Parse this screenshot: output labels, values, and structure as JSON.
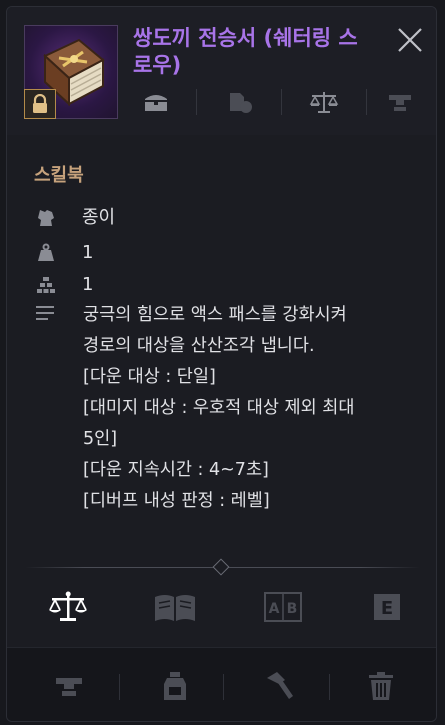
{
  "item": {
    "title": "쌍도끼 전승서 (쉐터링 스로우)",
    "category": "스킬북",
    "thumbnail_icon": "skillbook-icon",
    "lock_icon": "lock-icon"
  },
  "header_icons": [
    "storage-chest-icon",
    "upgrade-icon",
    "scale-icon",
    "anvil-icon"
  ],
  "properties": [
    {
      "icon": "material-icon",
      "value": "종이"
    },
    {
      "icon": "weight-icon",
      "value": "1"
    },
    {
      "icon": "stack-icon",
      "value": "1"
    }
  ],
  "description": {
    "icon": "description-icon",
    "lines": [
      "궁극의 힘으로 액스 패스를 강화시켜",
      "경로의 대상을 산산조각 냅니다.",
      "[다운 대상 : 단일]",
      "[대미지 대상 : 우호적 대상 제외 최대",
      "5인]",
      "[다운 지속시간 : 4~7초]",
      "[디버프 내성 판정 : 레벨]"
    ]
  },
  "tabs": [
    {
      "icon": "scale-icon",
      "active": true
    },
    {
      "icon": "open-book-icon",
      "active": false
    },
    {
      "icon": "ab-compare-icon",
      "active": false
    },
    {
      "icon": "e-key-icon",
      "active": false
    }
  ],
  "actions": [
    "anvil-icon",
    "potion-icon",
    "hammer-icon",
    "trash-icon"
  ],
  "colors": {
    "title": "#a874e8",
    "category": "#c6a27c",
    "text": "#e0e1e5",
    "icon_dim": "#4b4d55",
    "icon_mid": "#8a8c94",
    "tab_active": "#ffffff"
  }
}
